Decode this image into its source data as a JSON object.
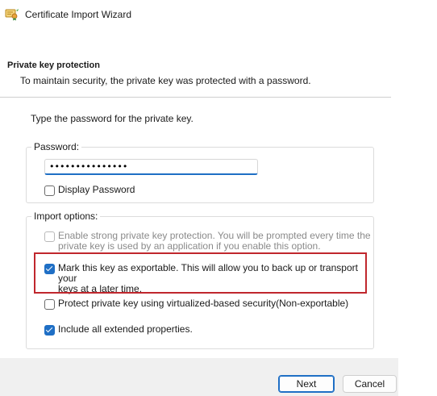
{
  "window": {
    "title": "Certificate Import Wizard"
  },
  "page": {
    "heading": "Private key protection",
    "subheading": "To maintain security, the private key was protected with a password.",
    "prompt": "Type the password for the private key."
  },
  "password_group": {
    "legend": "Password:",
    "value": "•••••••••••••••",
    "display_password_label": "Display Password",
    "display_password_checked": false
  },
  "import_options": {
    "legend": "Import options:",
    "strong_protection": {
      "line1": "Enable strong private key protection. You will be prompted every time the",
      "line2": "private key is used by an application if you enable this option.",
      "checked": false,
      "disabled": true
    },
    "exportable": {
      "line1": "Mark this key as exportable. This will allow you to back up or transport your",
      "line2": "keys at a later time.",
      "checked": true
    },
    "vbs": {
      "label": "Protect private key using virtualized-based security(Non-exportable)",
      "checked": false
    },
    "extended_properties": {
      "label": "Include all extended properties.",
      "checked": true
    }
  },
  "footer": {
    "next_label": "Next",
    "cancel_label": "Cancel"
  },
  "colors": {
    "accent": "#1f6fc5",
    "highlight": "#c0272d",
    "footer_bg": "#f0f0f0"
  },
  "icons": {
    "title": "certificate-icon"
  }
}
